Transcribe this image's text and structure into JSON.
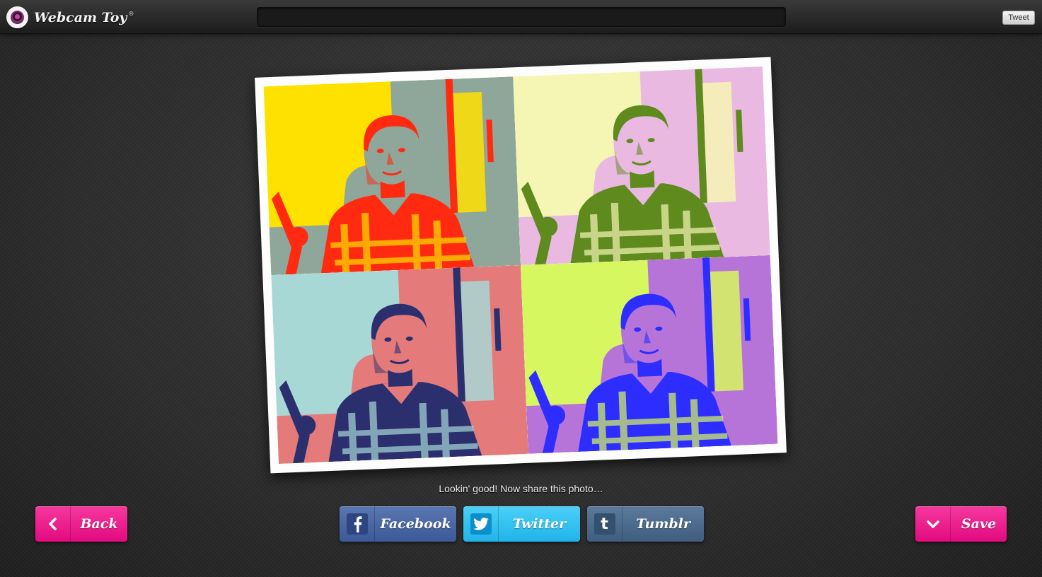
{
  "app": {
    "title": "Webcam Toy",
    "registered_mark": "®"
  },
  "header": {
    "url_bar_value": "",
    "tweet_label": "Tweet"
  },
  "photo": {
    "panels": [
      {
        "name": "yellow-red-panel",
        "bg": "#ffe100",
        "shade": "#ff2a10",
        "light": "#8fa79a"
      },
      {
        "name": "cream-green-panel",
        "bg": "#f6f6b4",
        "shade": "#5f8a1e",
        "light": "#eab9e2"
      },
      {
        "name": "teal-pink-panel",
        "bg": "#a8d8d6",
        "shade": "#2b2f6e",
        "light": "#e47a7a"
      },
      {
        "name": "lime-blue-panel",
        "bg": "#d7f760",
        "shade": "#2d2dff",
        "light": "#b774d8"
      }
    ]
  },
  "caption": "Lookin' good! Now share this photo…",
  "buttons": {
    "back": "Back",
    "facebook": "Facebook",
    "twitter": "Twitter",
    "tumblr": "Tumblr",
    "save": "Save"
  },
  "icons": {
    "back": "chevron-left-icon",
    "facebook": "facebook-icon",
    "twitter": "twitter-bird-icon",
    "tumblr": "tumblr-icon",
    "save": "chevron-down-icon"
  }
}
